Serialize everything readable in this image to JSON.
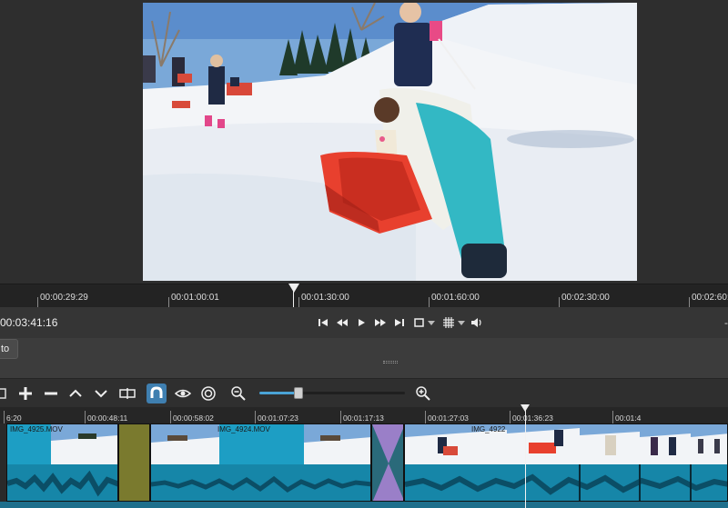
{
  "preview": {
    "ruler": [
      "00:00:29:29",
      "00:01:00:01",
      "00:01:30:00",
      "00:01:60:00",
      "00:02:30:00",
      "00:02:60:"
    ]
  },
  "transport": {
    "timecode": "00:03:41:16",
    "right_text": "-"
  },
  "midband": {
    "auto_label": "to"
  },
  "timeline": {
    "ruler": [
      "6:20",
      "00:00:48:11",
      "00:00:58:02",
      "00:01:07:23",
      "00:01:17:13",
      "00:01:27:03",
      "00:01:36:23",
      "00:01:4"
    ],
    "zoom_level": 0.27,
    "clips": [
      {
        "name": "IMG_4925.MOV"
      },
      {
        "name": ""
      },
      {
        "name": "IMG_4924.MOV"
      },
      {
        "name": ""
      },
      {
        "name": "IMG_4922"
      }
    ]
  },
  "colors": {
    "accent": "#3f7fb0",
    "clip_video": "#1d9ec4",
    "clip_audio": "#1686a8",
    "olive_clip": "#7a7a2e",
    "transition": "#9a7fc8"
  }
}
